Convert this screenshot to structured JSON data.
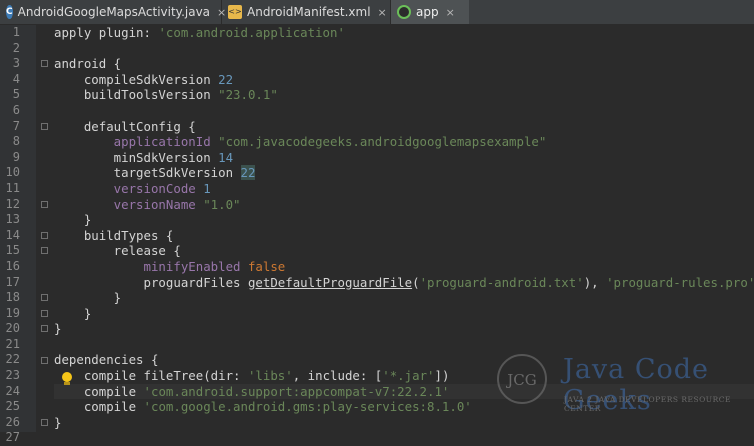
{
  "tabs": [
    {
      "label": "AndroidGoogleMapsActivity.java",
      "icon": "class-icon",
      "badge": "C"
    },
    {
      "label": "AndroidManifest.xml",
      "icon": "xml-icon",
      "badge": "<>"
    },
    {
      "label": "app",
      "icon": "gradle-icon",
      "active": true
    }
  ],
  "close_glyph": "×",
  "line_numbers": [
    "1",
    "2",
    "3",
    "4",
    "5",
    "6",
    "7",
    "8",
    "9",
    "10",
    "11",
    "12",
    "13",
    "14",
    "15",
    "16",
    "17",
    "18",
    "19",
    "20",
    "21",
    "22",
    "23",
    "24",
    "25",
    "26",
    "27"
  ],
  "code": [
    [
      {
        "c": "m",
        "t": "apply plugin: "
      },
      {
        "c": "s",
        "t": "'com.android.application'"
      }
    ],
    [],
    [
      {
        "c": "m",
        "t": "android {"
      }
    ],
    [
      {
        "c": "m",
        "t": "    compileSdkVersion "
      },
      {
        "c": "n",
        "t": "22"
      }
    ],
    [
      {
        "c": "m",
        "t": "    buildToolsVersion "
      },
      {
        "c": "s",
        "t": "\"23.0.1\""
      }
    ],
    [],
    [
      {
        "c": "m",
        "t": "    defaultConfig {"
      }
    ],
    [
      {
        "c": "p",
        "t": "        applicationId "
      },
      {
        "c": "s",
        "t": "\"com.javacodegeeks.androidgooglemapsexample\""
      }
    ],
    [
      {
        "c": "m",
        "t": "        minSdkVersion "
      },
      {
        "c": "n",
        "t": "14"
      }
    ],
    [
      {
        "c": "m",
        "t": "        targetSdkVersion "
      },
      {
        "c": "n hl",
        "t": "22"
      }
    ],
    [
      {
        "c": "p",
        "t": "        versionCode "
      },
      {
        "c": "n",
        "t": "1"
      }
    ],
    [
      {
        "c": "p",
        "t": "        versionName "
      },
      {
        "c": "s",
        "t": "\"1.0\""
      }
    ],
    [
      {
        "c": "m",
        "t": "    }"
      }
    ],
    [
      {
        "c": "m",
        "t": "    buildTypes {"
      }
    ],
    [
      {
        "c": "m",
        "t": "        release {"
      }
    ],
    [
      {
        "c": "p",
        "t": "            minifyEnabled "
      },
      {
        "c": "k",
        "t": "false"
      }
    ],
    [
      {
        "c": "m",
        "t": "            proguardFiles "
      },
      {
        "c": "m u",
        "t": "getDefaultProguardFile"
      },
      {
        "c": "m",
        "t": "("
      },
      {
        "c": "s",
        "t": "'proguard-android.txt'"
      },
      {
        "c": "m",
        "t": "), "
      },
      {
        "c": "s",
        "t": "'proguard-rules.pro'"
      }
    ],
    [
      {
        "c": "m",
        "t": "        }"
      }
    ],
    [
      {
        "c": "m",
        "t": "    }"
      }
    ],
    [
      {
        "c": "m",
        "t": "}"
      }
    ],
    [],
    [
      {
        "c": "m",
        "t": "dependencies {"
      }
    ],
    [
      {
        "c": "m",
        "t": "    compile fileTree(dir: "
      },
      {
        "c": "s",
        "t": "'libs'"
      },
      {
        "c": "m",
        "t": ", include: ["
      },
      {
        "c": "s",
        "t": "'*.jar'"
      },
      {
        "c": "m",
        "t": "])"
      }
    ],
    [
      {
        "c": "m",
        "t": "    compile "
      },
      {
        "c": "s",
        "t": "'com.android.support:appcompat-v7:22.2.1'"
      }
    ],
    [
      {
        "c": "m",
        "t": "    compile "
      },
      {
        "c": "s",
        "t": "'com.google.android.gms:play-services:8.1.0'"
      }
    ],
    [
      {
        "c": "m",
        "t": "}"
      }
    ],
    []
  ],
  "current_line": 24,
  "fold_lines": [
    3,
    7,
    12,
    14,
    15,
    18,
    19,
    20,
    22,
    26
  ],
  "watermark": {
    "logo": "JCG",
    "title": "Java Code Geeks",
    "subtitle": "JAVA 2 JAVA DEVELOPERS RESOURCE CENTER"
  },
  "colors": {
    "background": "#2b2b2b",
    "keyword": "#cc7832",
    "string": "#6a8759",
    "number": "#6897bb",
    "property": "#9876aa"
  }
}
